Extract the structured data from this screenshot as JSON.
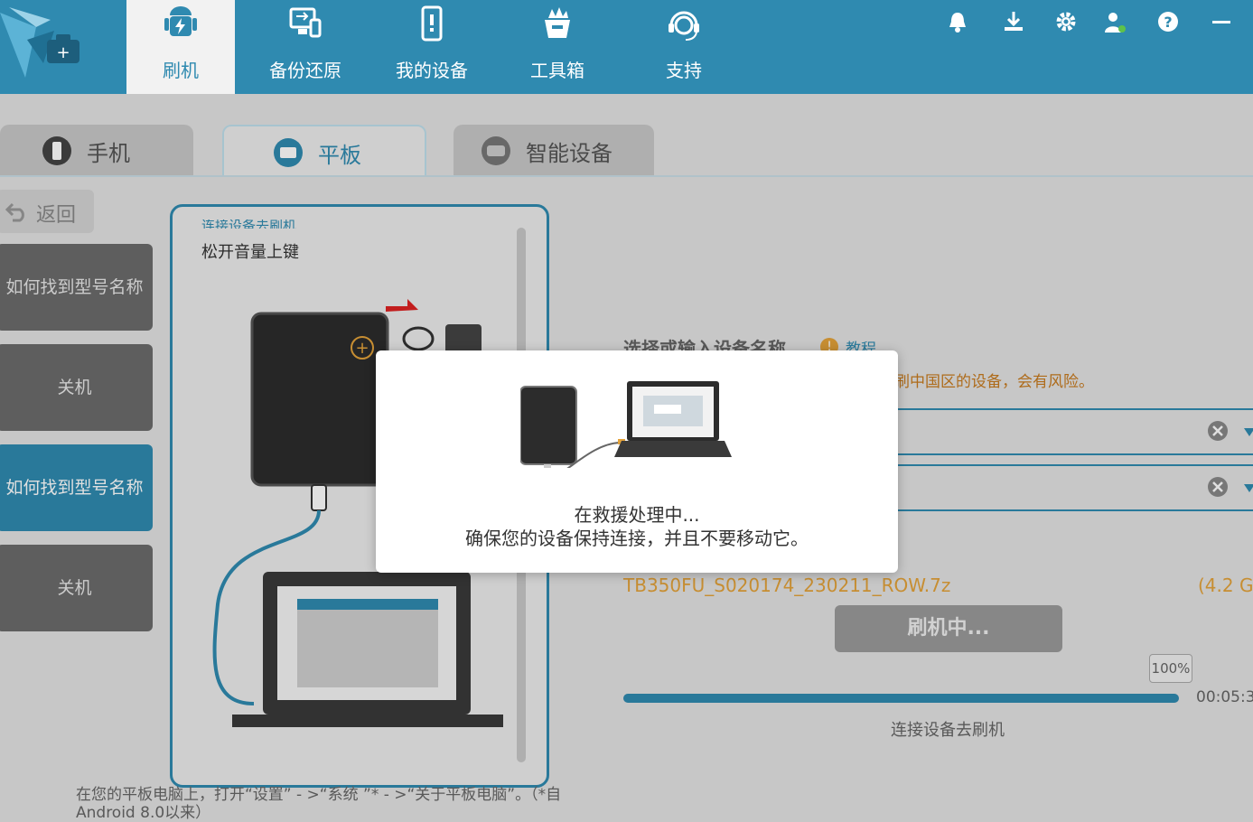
{
  "nav": {
    "items": [
      {
        "label": "刷机",
        "icon": "android-icon",
        "active": true
      },
      {
        "label": "备份还原",
        "icon": "backup-restore-icon",
        "active": false
      },
      {
        "label": "我的设备",
        "icon": "my-device-icon",
        "active": false
      },
      {
        "label": "工具箱",
        "icon": "toolbox-icon",
        "active": false
      },
      {
        "label": "支持",
        "icon": "support-headset-icon",
        "active": false
      }
    ],
    "top_icons": [
      "bell-icon",
      "download-icon",
      "gear-icon",
      "user-icon",
      "help-icon",
      "minimize-icon"
    ]
  },
  "tabs": [
    {
      "label": "手机",
      "icon": "phone-icon"
    },
    {
      "label": "平板",
      "icon": "tablet-icon",
      "active": true
    },
    {
      "label": "智能设备",
      "icon": "smart-device-icon"
    }
  ],
  "sidebar": {
    "back_label": "返回",
    "items": [
      {
        "label": "如何找到型号名称"
      },
      {
        "label": "关机"
      },
      {
        "label": "如何找到型号名称",
        "active": true
      },
      {
        "label": "关机"
      }
    ]
  },
  "guide": {
    "partial_text": "连接设备去刷机",
    "step_text": "松开音量上键",
    "footnote": "在您的平板电脑上，打开“设置” - >“系统 ”* - >“关于平板电脑”。（*自 Android 8.0以来）"
  },
  "right": {
    "heading": "选择或输入设备名称",
    "tutorial": "教程",
    "warning": "刷中国区的设备，会有风险。",
    "filename": "TB350FU_S020174_230211_ROW.7z",
    "filesize": "(4.2 G",
    "flash_button": "刷机中...",
    "progress_label": "100%",
    "progress": 1.0,
    "time": "00:05:3",
    "status": "连接设备去刷机"
  },
  "modal": {
    "line1": "在救援处理中...",
    "line2": "确保您的设备保持连接，并且不要移动它。"
  },
  "colors": {
    "brand": "#2f8ab0",
    "warning": "#c77a1e",
    "filename": "#e3a23a"
  }
}
